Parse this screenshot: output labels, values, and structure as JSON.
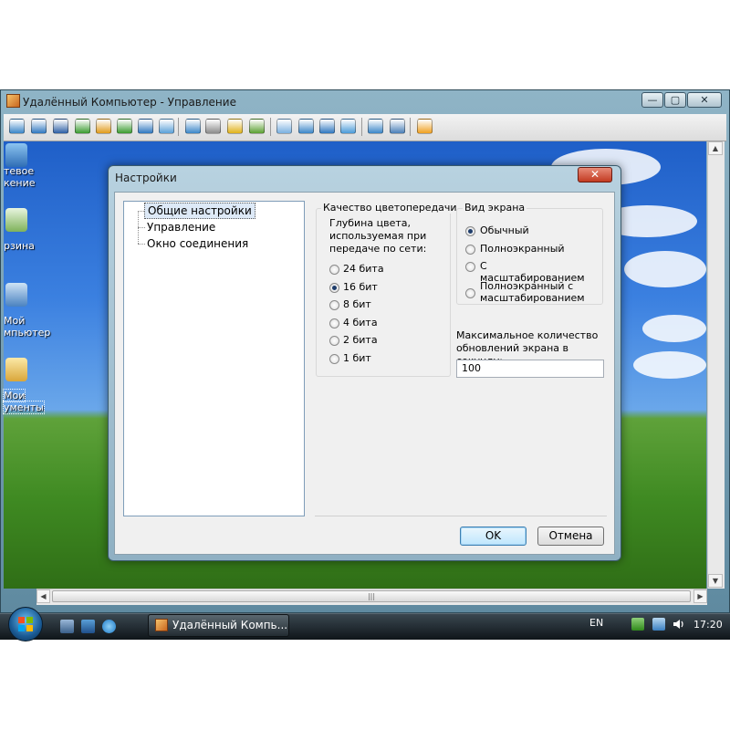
{
  "outer_window": {
    "title": "Удалённый Компьютер - Управление",
    "controls": {
      "minimize": "—",
      "maximize": "▢",
      "close": "✕"
    }
  },
  "toolbar": {
    "buttons": [
      {
        "icon": "monitor-icon",
        "color": "#3a86c8"
      },
      {
        "icon": "screen-icon",
        "color": "#2f78c0"
      },
      {
        "icon": "console-icon",
        "color": "#2d5fa5"
      },
      {
        "icon": "transfer-arrows-icon",
        "color": "#3a9b2f"
      },
      {
        "icon": "power-icon",
        "color": "#e09a1a"
      },
      {
        "icon": "monitor-check-icon",
        "color": "#3a9b2f"
      },
      {
        "icon": "phone-icon",
        "color": "#2f78c0"
      },
      {
        "icon": "chat-icon",
        "color": "#5aa0d8"
      },
      {
        "icon": "upload-icon",
        "color": "#3a86c8"
      },
      {
        "icon": "network-icon",
        "color": "#8a8a8a"
      },
      {
        "icon": "lock-icon",
        "color": "#e0b21a"
      },
      {
        "icon": "lock-green-icon",
        "color": "#5aa032"
      },
      {
        "icon": "view-normal-icon",
        "color": "#7ab0e0"
      },
      {
        "icon": "view-fullscreen-icon",
        "color": "#3a86c8"
      },
      {
        "icon": "view-scale-icon",
        "color": "#2f78c0"
      },
      {
        "icon": "view-fit-icon",
        "color": "#4a9ad8"
      },
      {
        "icon": "refresh-icon",
        "color": "#3a86c8"
      },
      {
        "icon": "settings-tools-icon",
        "color": "#4a7fb8"
      },
      {
        "icon": "close-session-icon",
        "color": "#f0a020"
      }
    ]
  },
  "desktop": {
    "icons": [
      {
        "label_line1": "тевое",
        "label_line2": "кение",
        "icon": "network-places-icon"
      },
      {
        "label_line1": "рзина",
        "label_line2": "",
        "icon": "recycle-bin-icon"
      },
      {
        "label_line1": "Мой",
        "label_line2": "мпьютер",
        "icon": "my-computer-icon"
      },
      {
        "label_line1": "Мои",
        "label_line2": "ументы",
        "icon": "my-documents-icon"
      }
    ],
    "scroll_thumb_grip": "|||"
  },
  "dialog": {
    "title": "Настройки",
    "close_label": "✕",
    "tree": {
      "selected": "Общие настройки",
      "items": [
        "Управление",
        "Окно соединения"
      ]
    },
    "color_quality": {
      "group_label": "Качество цветопередачи",
      "description": "Глубина цвета, используемая при передаче по сети:",
      "options": [
        "24 бита",
        "16 бит",
        "8 бит",
        "4 бита",
        "2 бита",
        "1 бит"
      ],
      "selected": "16 бит"
    },
    "screen_view": {
      "group_label": "Вид экрана",
      "options": [
        "Обычный",
        "Полноэкранный",
        "С масштабированием",
        "Полноэкранный с масштабированием"
      ],
      "selected": "Обычный"
    },
    "max_updates": {
      "label": "Максимальное количество обновлений экрана в секунду:",
      "value": "100"
    },
    "ok_label": "OK",
    "cancel_label": "Отмена"
  },
  "taskbar": {
    "task_label": "Удалённый Компь...",
    "language": "EN",
    "time": "17:20",
    "quick_launch": [
      "show-desktop-icon",
      "switch-windows-icon",
      "internet-explorer-icon"
    ],
    "tray": [
      "network-tray-icon",
      "security-tray-icon",
      "volume-icon"
    ]
  }
}
